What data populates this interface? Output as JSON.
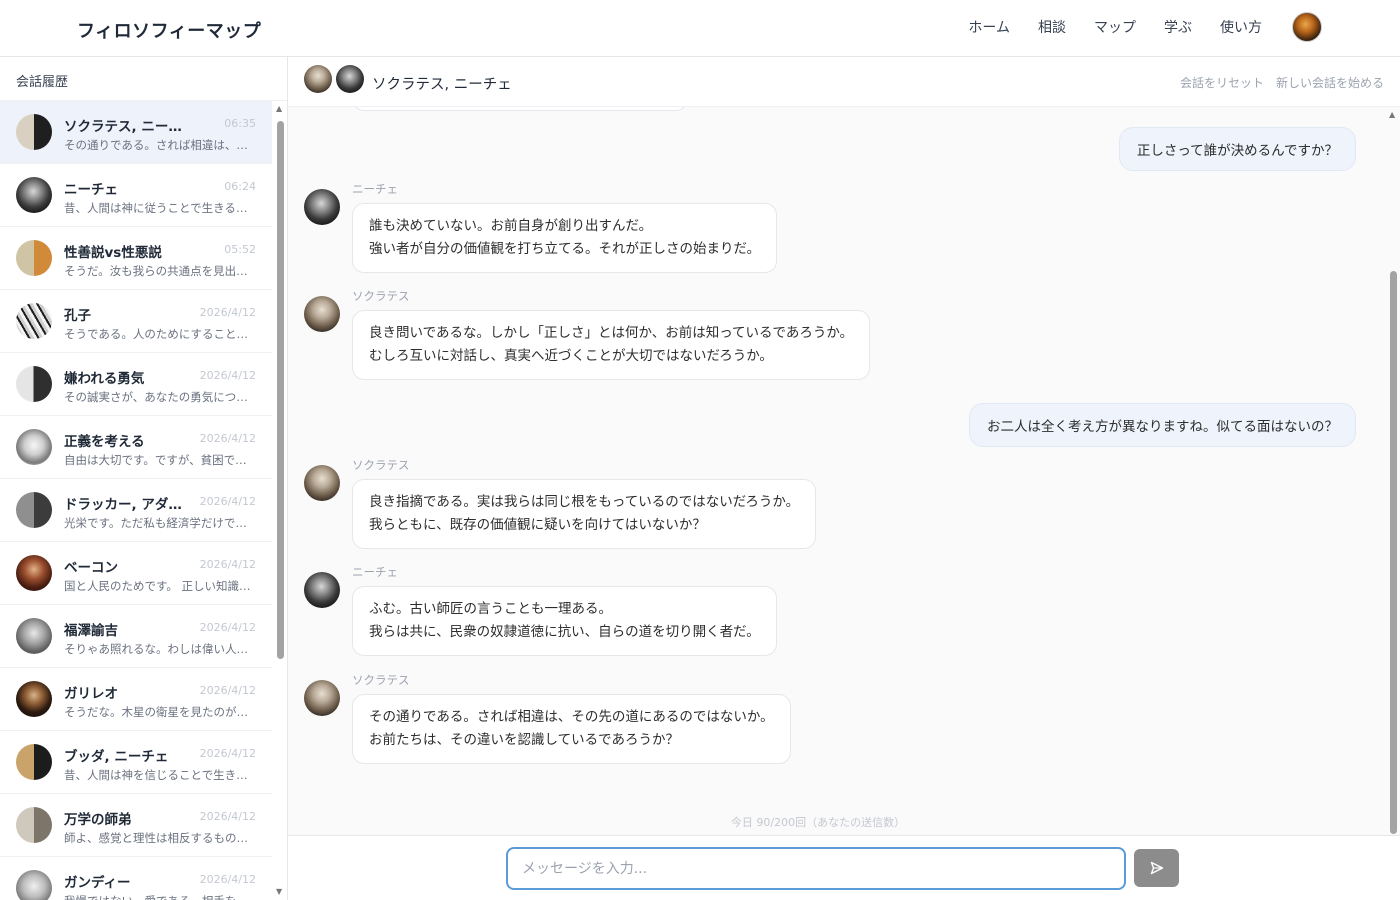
{
  "app": {
    "brand": "フィロソフィーマップ",
    "nav": [
      "ホーム",
      "相談",
      "マップ",
      "学ぶ",
      "使い方"
    ]
  },
  "sidebar": {
    "title": "会話履歴",
    "items": [
      {
        "name": "ソクラテス, ニーチェ",
        "time": "06:35",
        "preview": "その通りである。されば相違は、その先の道にあるのではないか。",
        "avatar": "p-mix"
      },
      {
        "name": "ニーチェ",
        "time": "06:24",
        "preview": "昔、人間は神に従うことで生きることを選んだ。",
        "avatar": "p-nie"
      },
      {
        "name": "性善説vs性悪説",
        "time": "05:52",
        "preview": "そうだ。汝も我らの共通点を見出したか。",
        "avatar": "p-zen"
      },
      {
        "name": "孔子",
        "time": "2026/4/12",
        "preview": "そうである。人のためにすることこそ仁である。",
        "avatar": "p-con"
      },
      {
        "name": "嫌われる勇気",
        "time": "2026/4/12",
        "preview": "その誠実さが、あなたの勇気につながります。",
        "avatar": "p-adl"
      },
      {
        "name": "正義を考える",
        "time": "2026/4/12",
        "preview": "自由は大切です。ですが、貧困で選択肢を持てない人もいます。",
        "avatar": "p-jus"
      },
      {
        "name": "ドラッカー, アダム・スミス",
        "time": "2026/4/12",
        "preview": "光栄です。ただ私も経済学だけでは語れません。",
        "avatar": "p-dru"
      },
      {
        "name": "ベーコン",
        "time": "2026/4/12",
        "preview": "国と人民のためです。 正しい知識こそが力なのです。",
        "avatar": "p-bac"
      },
      {
        "name": "福澤諭吉",
        "time": "2026/4/12",
        "preview": "そりゃあ照れるな。わしは偉い人間ではないぞ。",
        "avatar": "p-fuk"
      },
      {
        "name": "ガリレオ",
        "time": "2026/4/12",
        "preview": "そうだな。木星の衛星を見たのが始まりだ。",
        "avatar": "p-gal"
      },
      {
        "name": "ブッダ, ニーチェ",
        "time": "2026/4/12",
        "preview": "昔、人間は神を信じることで生きてきた。",
        "avatar": "p-bud"
      },
      {
        "name": "万学の師弟",
        "time": "2026/4/12",
        "preview": "師よ、感覚と理性は相反するものではありません。",
        "avatar": "p-ban"
      },
      {
        "name": "ガンディー",
        "time": "2026/4/12",
        "preview": "我慢ではない。愛である。相手を変えるのだ。",
        "avatar": "p-gan"
      }
    ]
  },
  "chat": {
    "title": "ソクラテス, ニーチェ",
    "actions": {
      "reset": "会話をリセット",
      "new": "新しい会話を始める"
    },
    "messages": [
      {
        "role": "user",
        "text": "正しさって誰が決めるんですか？"
      },
      {
        "role": "ai",
        "speaker": "ニーチェ",
        "avatar": "p-nie",
        "lines": [
          "誰も決めていない。お前自身が創り出すんだ。",
          "強い者が自分の価値観を打ち立てる。それが正しさの始まりだ。"
        ]
      },
      {
        "role": "ai",
        "speaker": "ソクラテス",
        "avatar": "p-soc",
        "lines": [
          "良き問いであるな。しかし「正しさ」とは何か、お前は知っているであろうか。",
          "むしろ互いに対話し、真実へ近づくことが大切ではないだろうか。"
        ]
      },
      {
        "role": "user",
        "text": "お二人は全く考え方が異なりますね。似てる面はないの？"
      },
      {
        "role": "ai",
        "speaker": "ソクラテス",
        "avatar": "p-soc",
        "lines": [
          "良き指摘である。実は我らは同じ根をもっているのではないだろうか。",
          "我らともに、既存の価値観に疑いを向けてはいないか？"
        ]
      },
      {
        "role": "ai",
        "speaker": "ニーチェ",
        "avatar": "p-nie",
        "lines": [
          "ふむ。古い師匠の言うことも一理ある。",
          "我らは共に、民衆の奴隷道徳に抗い、自らの道を切り開く者だ。"
        ]
      },
      {
        "role": "ai",
        "speaker": "ソクラテス",
        "avatar": "p-soc",
        "lines": [
          "その通りである。されば相違は、その先の道にあるのではないか。",
          "お前たちは、その違いを認識しているであろうか？"
        ]
      }
    ],
    "counter": "今日 90/200回（あなたの送信数）",
    "input_placeholder": "メッセージを入力..."
  },
  "icons": {
    "send": "send-icon",
    "user": "user-avatar"
  }
}
